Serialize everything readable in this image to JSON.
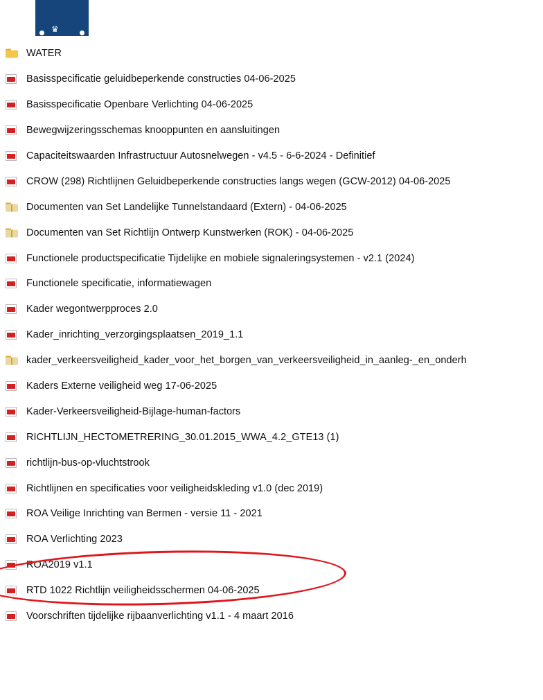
{
  "header": {
    "logo_icon": "rijksoverheid-crown-logo",
    "brand_color": "#15457b"
  },
  "annotation": {
    "shape": "ellipse",
    "color": "#e0161c",
    "target_index": 21
  },
  "files": [
    {
      "type": "folder",
      "icon": "folder-icon",
      "name": "WATER"
    },
    {
      "type": "pdf",
      "icon": "pdf-icon",
      "name": "Basisspecificatie geluidbeperkende constructies 04-06-2025"
    },
    {
      "type": "pdf",
      "icon": "pdf-icon",
      "name": "Basisspecificatie Openbare Verlichting 04-06-2025"
    },
    {
      "type": "pdf",
      "icon": "pdf-icon",
      "name": "Bewegwijzeringsschemas knooppunten en aansluitingen"
    },
    {
      "type": "pdf",
      "icon": "pdf-icon",
      "name": "Capaciteitswaarden Infrastructuur Autosnelwegen - v4.5 - 6-6-2024 - Definitief"
    },
    {
      "type": "pdf",
      "icon": "pdf-icon",
      "name": "CROW (298) Richtlijnen Geluidbeperkende constructies langs wegen (GCW-2012) 04-06-2025"
    },
    {
      "type": "zip",
      "icon": "zip-folder-icon",
      "name": "Documenten van Set Landelijke Tunnelstandaard (Extern) - 04-06-2025"
    },
    {
      "type": "zip",
      "icon": "zip-folder-icon",
      "name": "Documenten van Set Richtlijn Ontwerp Kunstwerken (ROK) - 04-06-2025"
    },
    {
      "type": "pdf",
      "icon": "pdf-icon",
      "name": "Functionele productspecificatie Tijdelijke en mobiele signaleringsystemen - v2.1 (2024)"
    },
    {
      "type": "pdf",
      "icon": "pdf-icon",
      "name": "Functionele specificatie, informatiewagen"
    },
    {
      "type": "pdf",
      "icon": "pdf-icon",
      "name": "Kader wegontwerpproces 2.0"
    },
    {
      "type": "pdf",
      "icon": "pdf-icon",
      "name": "Kader_inrichting_verzorgingsplaatsen_2019_1.1"
    },
    {
      "type": "zip",
      "icon": "zip-folder-icon",
      "name": "kader_verkeersveiligheid_kader_voor_het_borgen_van_verkeersveiligheid_in_aanleg-_en_onderh"
    },
    {
      "type": "pdf",
      "icon": "pdf-icon",
      "name": "Kaders Externe veiligheid weg  17-06-2025"
    },
    {
      "type": "pdf",
      "icon": "pdf-icon",
      "name": "Kader-Verkeersveiligheid-Bijlage-human-factors"
    },
    {
      "type": "pdf",
      "icon": "pdf-icon",
      "name": "RICHTLIJN_HECTOMETRERING_30.01.2015_WWA_4.2_GTE13 (1)"
    },
    {
      "type": "pdf",
      "icon": "pdf-icon",
      "name": "richtlijn-bus-op-vluchtstrook"
    },
    {
      "type": "pdf",
      "icon": "pdf-icon",
      "name": "Richtlijnen en specificaties voor veiligheidskleding v1.0 (dec 2019)"
    },
    {
      "type": "pdf",
      "icon": "pdf-icon",
      "name": "ROA Veilige Inrichting van Bermen - versie 11 - 2021"
    },
    {
      "type": "pdf",
      "icon": "pdf-icon",
      "name": "ROA Verlichting 2023"
    },
    {
      "type": "pdf",
      "icon": "pdf-icon",
      "name": "ROA2019 v1.1"
    },
    {
      "type": "pdf",
      "icon": "pdf-icon",
      "name": "RTD 1022 Richtlijn veiligheidsschermen 04-06-2025"
    },
    {
      "type": "pdf",
      "icon": "pdf-icon",
      "name": "Voorschriften tijdelijke rijbaanverlichting v1.1 - 4 maart 2016"
    }
  ]
}
